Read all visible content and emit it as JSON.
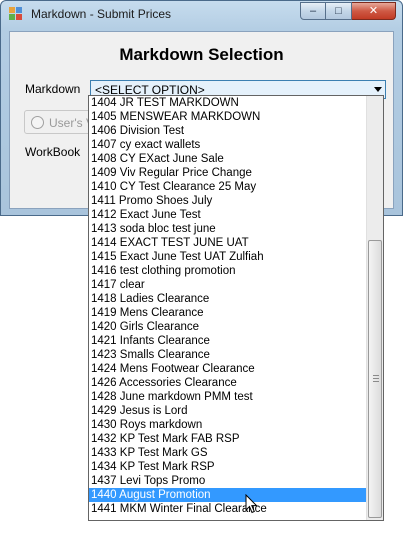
{
  "window": {
    "title": "Markdown - Submit Prices",
    "minimize_glyph": "–",
    "maximize_glyph": "□",
    "close_glyph": "✕"
  },
  "form": {
    "heading": "Markdown Selection",
    "markdown_label": "Markdown",
    "markdown_value": "<SELECT OPTION>",
    "radio_label": "User's V",
    "workbook_label": "WorkBook"
  },
  "dropdown": {
    "selected_index": 28,
    "items": [
      "1404 JR TEST MARKDOWN",
      "1405 MENSWEAR MARKDOWN",
      "1406 Division Test",
      "1407 cy exact wallets",
      "1408 CY EXact June Sale",
      "1409 Viv Regular Price Change",
      "1410 CY Test Clearance 25 May",
      "1411 Promo Shoes July",
      "1412 Exact June Test",
      "1413 soda bloc test june",
      "1414 EXACT TEST JUNE  UAT",
      "1415 Exact June Test UAT Zulfiah",
      "1416 test clothing promotion",
      "1417 clear",
      "1418 Ladies Clearance",
      "1419 Mens Clearance",
      "1420 Girls Clearance",
      "1421 Infants Clearance",
      "1423 Smalls Clearance",
      "1424 Mens Footwear Clearance",
      "1426 Accessories Clearance",
      "1428 June markdown PMM test",
      "1429 Jesus is Lord",
      "1430 Roys markdown",
      "1432 KP Test Mark FAB RSP",
      "1433 KP Test Mark GS",
      "1434 KP Test Mark RSP",
      "1437 Levi Tops Promo",
      "1440 August Promotion",
      "1441 MKM Winter Final Clearance"
    ]
  },
  "colors": {
    "selection": "#3399ff",
    "combo_border": "#3c7fb1",
    "close_button": "#c13b25"
  }
}
